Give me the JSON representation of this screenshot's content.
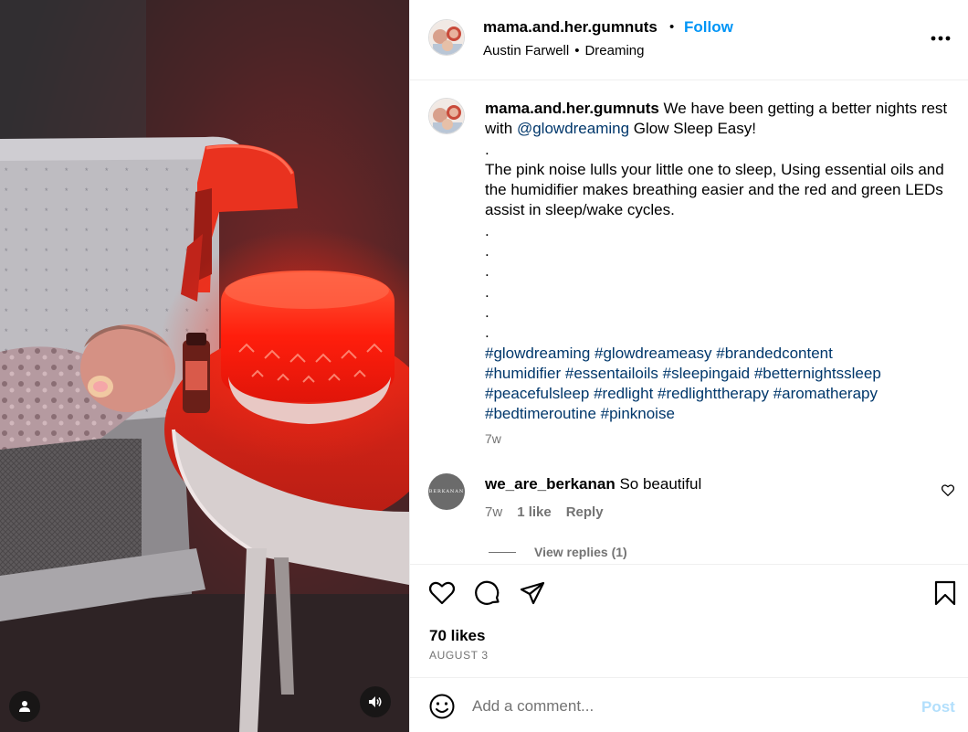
{
  "post": {
    "username": "mama.and.her.gumnuts",
    "follow_label": "Follow",
    "audio_artist": "Austin Farwell",
    "audio_title": "Dreaming"
  },
  "caption": {
    "username": "mama.and.her.gumnuts",
    "text_before_mention": " We have been getting a better nights rest with ",
    "mention": "@glowdreaming",
    "text_after_mention": " Glow Sleep Easy!",
    "dot": ".",
    "paragraph": "The pink noise lulls your little one to sleep, Using essential oils and the humidifier makes breathing easier and the red and green LEDs assist in sleep/wake cycles.",
    "hashtags_line1": "#glowdreaming #glowdreameasy #brandedcontent",
    "hashtags_line2": "#humidifier #essentailoils #sleepingaid #betternightssleep",
    "hashtags_line3": "#peacefulsleep #redlight #redlighttherapy #aromatherapy",
    "hashtags_line4": "#bedtimeroutine #pinknoise",
    "time": "7w"
  },
  "comment": {
    "avatar_text": "BERKANAN",
    "username": "we_are_berkanan",
    "text": "So beautiful",
    "time": "7w",
    "likes": "1 like",
    "reply_label": "Reply",
    "view_replies": "View replies (1)"
  },
  "actions": {
    "likes": "70 likes",
    "date": "AUGUST 3"
  },
  "comment_box": {
    "placeholder": "Add a comment...",
    "post_label": "Post"
  },
  "colors": {
    "link": "#0095f6",
    "mention": "#00376b",
    "muted": "#737373",
    "post_disabled": "#b2dffc",
    "lamp_red": "#ff1f10"
  },
  "icons": [
    "user-tag-icon",
    "sound-icon",
    "more-icon",
    "heart-icon",
    "comment-icon",
    "share-icon",
    "bookmark-icon",
    "emoji-icon",
    "small-heart-icon"
  ]
}
